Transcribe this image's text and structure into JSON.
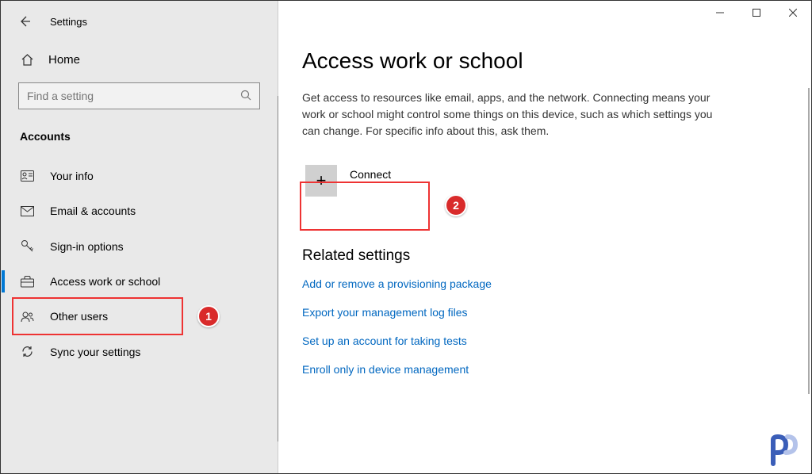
{
  "window": {
    "title": "Settings"
  },
  "sidebar": {
    "home": "Home",
    "search_placeholder": "Find a setting",
    "category": "Accounts",
    "items": [
      {
        "label": "Your info"
      },
      {
        "label": "Email & accounts"
      },
      {
        "label": "Sign-in options"
      },
      {
        "label": "Access work or school"
      },
      {
        "label": "Other users"
      },
      {
        "label": "Sync your settings"
      }
    ]
  },
  "main": {
    "title": "Access work or school",
    "description": "Get access to resources like email, apps, and the network. Connecting means your work or school might control some things on this device, such as which settings you can change. For specific info about this, ask them.",
    "connect_label": "Connect",
    "related_title": "Related settings",
    "links": [
      "Add or remove a provisioning package",
      "Export your management log files",
      "Set up an account for taking tests",
      "Enroll only in device management"
    ]
  },
  "annotations": {
    "badge1": "1",
    "badge2": "2"
  }
}
